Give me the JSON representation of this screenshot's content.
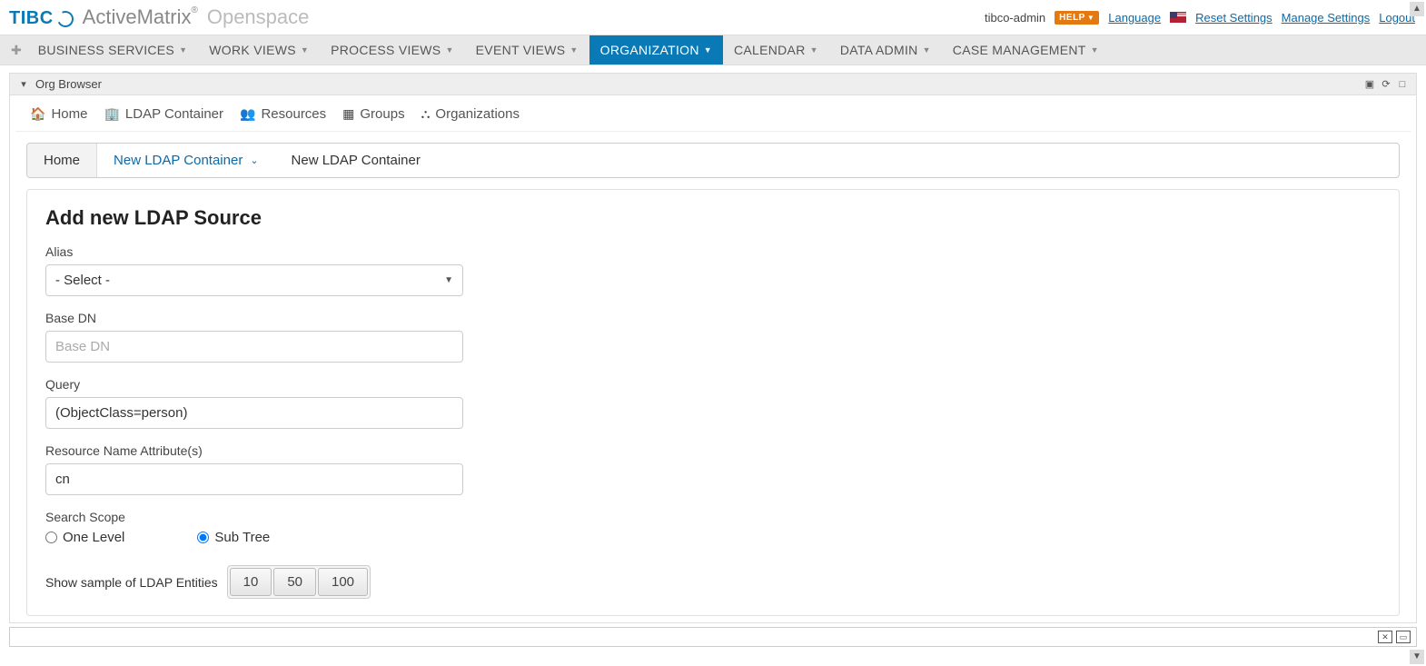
{
  "brand": {
    "logo_text": "TIBC",
    "am": "ActiveMatrix",
    "reg": "®",
    "os": "Openspace"
  },
  "topbar": {
    "user": "tibco-admin",
    "help": "HELP",
    "language": "Language",
    "reset": "Reset Settings",
    "manage": "Manage Settings",
    "logout": "Logout"
  },
  "menu": {
    "items": [
      "BUSINESS SERVICES",
      "WORK VIEWS",
      "PROCESS VIEWS",
      "EVENT VIEWS",
      "ORGANIZATION",
      "CALENDAR",
      "DATA ADMIN",
      "CASE MANAGEMENT"
    ],
    "active_index": 4
  },
  "panel": {
    "title": "Org Browser"
  },
  "inner_tabs": [
    {
      "icon": "home",
      "label": "Home"
    },
    {
      "icon": "building",
      "label": "LDAP Container"
    },
    {
      "icon": "users",
      "label": "Resources"
    },
    {
      "icon": "grid",
      "label": "Groups"
    },
    {
      "icon": "sitemap",
      "label": "Organizations"
    }
  ],
  "breadcrumb": {
    "home": "Home",
    "link": "New LDAP Container",
    "current": "New LDAP Container"
  },
  "form": {
    "title": "Add new LDAP Source",
    "alias_label": "Alias",
    "alias_value": "- Select -",
    "basedn_label": "Base DN",
    "basedn_placeholder": "Base DN",
    "basedn_value": "",
    "query_label": "Query",
    "query_value": "(ObjectClass=person)",
    "rna_label": "Resource Name Attribute(s)",
    "rna_value": "cn",
    "scope_label": "Search Scope",
    "scope_one": "One Level",
    "scope_sub": "Sub Tree",
    "scope_selected": "sub",
    "sample_label": "Show sample of LDAP Entities",
    "sample_options": [
      "10",
      "50",
      "100"
    ]
  }
}
